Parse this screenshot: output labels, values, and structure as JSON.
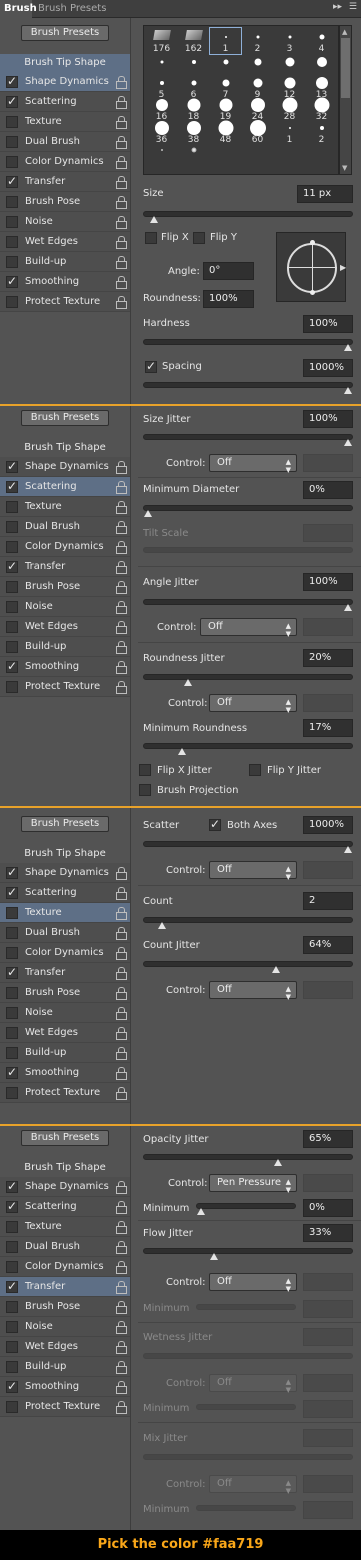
{
  "tabs": {
    "brush": "Brush",
    "presets": "Brush Presets"
  },
  "preset_button": "Brush Presets",
  "tip_shape": "Brush Tip Shape",
  "accent": "#faa719",
  "sidebar_items": [
    "Shape Dynamics",
    "Scattering",
    "Texture",
    "Dual Brush",
    "Color Dynamics",
    "Transfer",
    "Brush Pose",
    "Noise",
    "Wet Edges",
    "Build-up",
    "Smoothing",
    "Protect Texture"
  ],
  "checked_states": [
    true,
    true,
    false,
    false,
    false,
    true,
    false,
    false,
    false,
    false,
    true,
    false
  ],
  "brush_grid": [
    "176",
    "162",
    "1",
    "2",
    "3",
    "4",
    "",
    "",
    "",
    "",
    "",
    "",
    "5",
    "6",
    "7",
    "9",
    "12",
    "13",
    "16",
    "18",
    "19",
    "24",
    "28",
    "32",
    "36",
    "38",
    "48",
    "60",
    "1",
    "2",
    "",
    ""
  ],
  "p1": {
    "size_label": "Size",
    "size_value": "11 px",
    "size_level": 0.03,
    "flipx": "Flip X",
    "flipy": "Flip Y",
    "angle_label": "Angle:",
    "angle_value": "0°",
    "round_label": "Roundness:",
    "round_value": "100%",
    "hard_label": "Hardness",
    "hard_value": "100%",
    "hard_level": 1.0,
    "spacing_label": "Spacing",
    "spacing_value": "1000%",
    "spacing_level": 1.0
  },
  "p2": {
    "size_jitter": "Size Jitter",
    "size_jitter_value": "100%",
    "size_jitter_level": 1.0,
    "control": "Control:",
    "control_value": "Off",
    "min_diam": "Minimum Diameter",
    "min_diam_value": "0%",
    "min_diam_level": 0.0,
    "tilt": "Tilt Scale",
    "angle_jitter": "Angle Jitter",
    "angle_jitter_value": "100%",
    "angle_jitter_level": 1.0,
    "control2": "Control:",
    "control2_value": "Off",
    "round_jitter": "Roundness Jitter",
    "round_jitter_value": "20%",
    "round_jitter_level": 0.2,
    "control3": "Control:",
    "control3_value": "Off",
    "min_round": "Minimum Roundness",
    "min_round_value": "17%",
    "min_round_level": 0.17,
    "flipx_j": "Flip X Jitter",
    "flipy_j": "Flip Y Jitter",
    "proj": "Brush Projection"
  },
  "p3": {
    "scatter": "Scatter",
    "both": "Both Axes",
    "scatter_value": "1000%",
    "scatter_level": 1.0,
    "control": "Control:",
    "control_value": "Off",
    "count": "Count",
    "count_value": "2",
    "count_level": 0.07,
    "count_jitter": "Count Jitter",
    "count_jitter_value": "64%",
    "count_jitter_level": 0.64,
    "control2": "Control:",
    "control2_value": "Off"
  },
  "p4": {
    "op_jitter": "Opacity Jitter",
    "op_jitter_value": "65%",
    "op_jitter_level": 0.65,
    "control": "Control:",
    "control_value": "Pen Pressure",
    "minimum": "Minimum",
    "minimum_value": "0%",
    "minimum_level": 0.0,
    "flow_jitter": "Flow Jitter",
    "flow_jitter_value": "33%",
    "flow_jitter_level": 0.33,
    "control2": "Control:",
    "control2_value": "Off",
    "minimum2": "Minimum",
    "wet_jitter": "Wetness Jitter",
    "control3": "Control:",
    "control3_value": "Off",
    "minimum3": "Minimum",
    "mix_jitter": "Mix Jitter",
    "control4": "Control:",
    "control4_value": "Off",
    "minimum4": "Minimum"
  },
  "footer": "Pick the color #faa719"
}
